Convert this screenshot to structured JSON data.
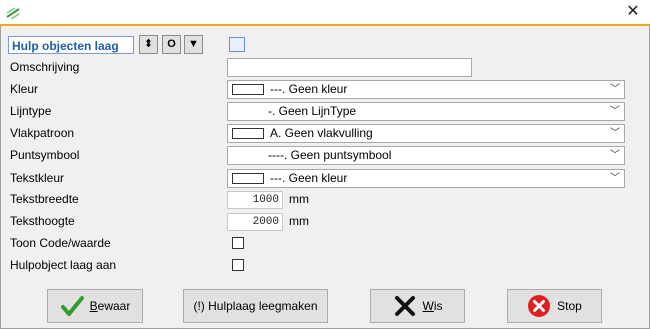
{
  "window": {
    "close_glyph": "✕"
  },
  "layer": {
    "name": "Hulp objecten laag",
    "btn_updown": "⬍",
    "btn_o": "O",
    "btn_down": "▼"
  },
  "form": {
    "omschrijving": {
      "label": "Omschrijving",
      "value": ""
    },
    "kleur": {
      "label": "Kleur",
      "value": "---. Geen kleur"
    },
    "lijntype": {
      "label": "Lijntype",
      "value": "-. Geen LijnType"
    },
    "vlakpatroon": {
      "label": "Vlakpatroon",
      "value": "A. Geen vlakvulling"
    },
    "puntsymbool": {
      "label": "Puntsymbool",
      "value": "----. Geen puntsymbool"
    },
    "tekstkleur": {
      "label": "Tekstkleur",
      "value": "---. Geen kleur"
    },
    "tekstbreedte": {
      "label": "Tekstbreedte",
      "value": "1000",
      "unit": "mm"
    },
    "teksthoogte": {
      "label": "Teksthoogte",
      "value": "2000",
      "unit": "mm"
    },
    "toon_code": {
      "label": "Toon Code/waarde",
      "checked": false
    },
    "hulpobject_aan": {
      "label": "Hulpobject laag aan",
      "checked": false
    }
  },
  "buttons": {
    "bewaar": {
      "mnemonic": "B",
      "rest": "ewaar"
    },
    "leegmaken": {
      "label": "(!) Hulplaag leegmaken"
    },
    "wis": {
      "mnemonic": "W",
      "rest": "is"
    },
    "stop": {
      "label": "Stop"
    }
  },
  "colors": {
    "title_accent": "#f5a623",
    "layer_text": "#1f5fa8",
    "ok_green": "#2f9e2f",
    "stop_red": "#e02020"
  }
}
